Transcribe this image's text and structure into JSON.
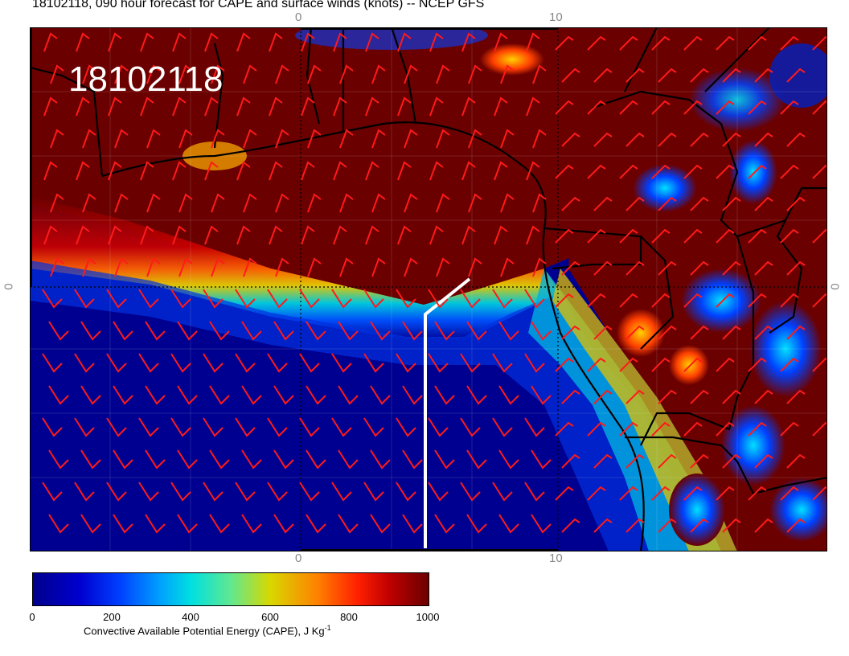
{
  "title": "18102118, 090 hour forecast for CAPE and surface winds (knots) -- NCEP GFS",
  "stamp": "18102118",
  "ticks": {
    "top_0": "0",
    "top_10": "10",
    "bottom_0": "0",
    "bottom_10": "10",
    "left_0": "0",
    "right_0": "0"
  },
  "colorbar": {
    "title": "Convective Available Potential Energy (CAPE), J Kg",
    "title_sup": "-1",
    "labels": [
      "0",
      "200",
      "400",
      "600",
      "800",
      "1000"
    ],
    "colors": [
      "#00008b",
      "#0040ff",
      "#00e0e0",
      "#d8d800",
      "#ff2000",
      "#6b0000"
    ]
  },
  "colors": {
    "high_cape": "#6b0000",
    "low_cape": "#000090",
    "wind_barb": "#ff1a1a",
    "coastline": "#000000",
    "transect": "#ffffff"
  }
}
